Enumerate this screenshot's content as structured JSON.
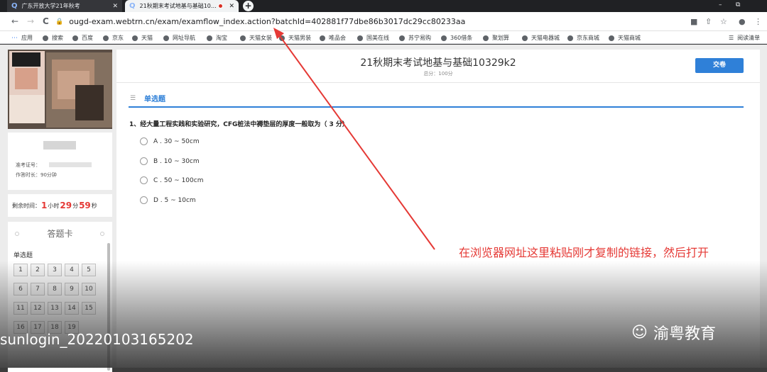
{
  "tabs": [
    {
      "label": "广东开放大学21年秋考",
      "close": "✕",
      "icon": "Q"
    },
    {
      "label": "21秋期末考试地基与基础10…",
      "close": "✕",
      "icon": "Q"
    }
  ],
  "new_tab": "+",
  "window_controls": {
    "minimize": "–",
    "maximize": "⧉"
  },
  "toolbar": {
    "back": "←",
    "forward": "→",
    "reload": "C",
    "url": "ougd-exam.webtrn.cn/exam/examflow_index.action?batchId=402881f77dbe86b3017dc29cc80233aa"
  },
  "bookmarks": {
    "apps": "应用",
    "items": [
      "搜索",
      "百度",
      "京东",
      "天猫",
      "网址导航",
      "淘宝",
      "天猫女装",
      "天猫男装",
      "唯品会",
      "国美在线",
      "苏宁易购",
      "360借条",
      "聚划算",
      "天猫电器城",
      "京东商城",
      "天猫商城"
    ],
    "reading_list": "阅读清单"
  },
  "student": {
    "id_label": "准考证号：",
    "time_label": "作答时长：90分钟"
  },
  "timer": {
    "label": "剩余时间：",
    "hours": "1",
    "hours_unit": "小时",
    "minutes": "29",
    "minutes_unit": "分",
    "seconds": "59",
    "seconds_unit": "秒"
  },
  "answer_card": {
    "title": "答题卡",
    "section": "单选题",
    "numbers": [
      "1",
      "2",
      "3",
      "4",
      "5",
      "6",
      "7",
      "8",
      "9",
      "10",
      "11",
      "12",
      "13",
      "14",
      "15",
      "16",
      "17",
      "18",
      "19"
    ]
  },
  "exam": {
    "title": "21秋期末考试地基与基础10329k2",
    "score": "总分：100分",
    "submit": "交卷",
    "section": "单选题",
    "question": "1、经大量工程实践和实验研究，CFG桩法中褥垫层的厚度一般取为（ 3 分）",
    "options": [
      "A . 30 ~ 50cm",
      "B . 10 ~ 30cm",
      "C . 50 ~ 100cm",
      "D . 5 ~ 10cm"
    ]
  },
  "annotation": "在浏览器网址这里粘贴刚才复制的链接，然后打开",
  "watermark": "sunlogin_20220103165202",
  "brand": "渝粤教育",
  "colors": {
    "accent": "#2f80d8",
    "annotation": "#e53935",
    "timer": "#e53935"
  }
}
